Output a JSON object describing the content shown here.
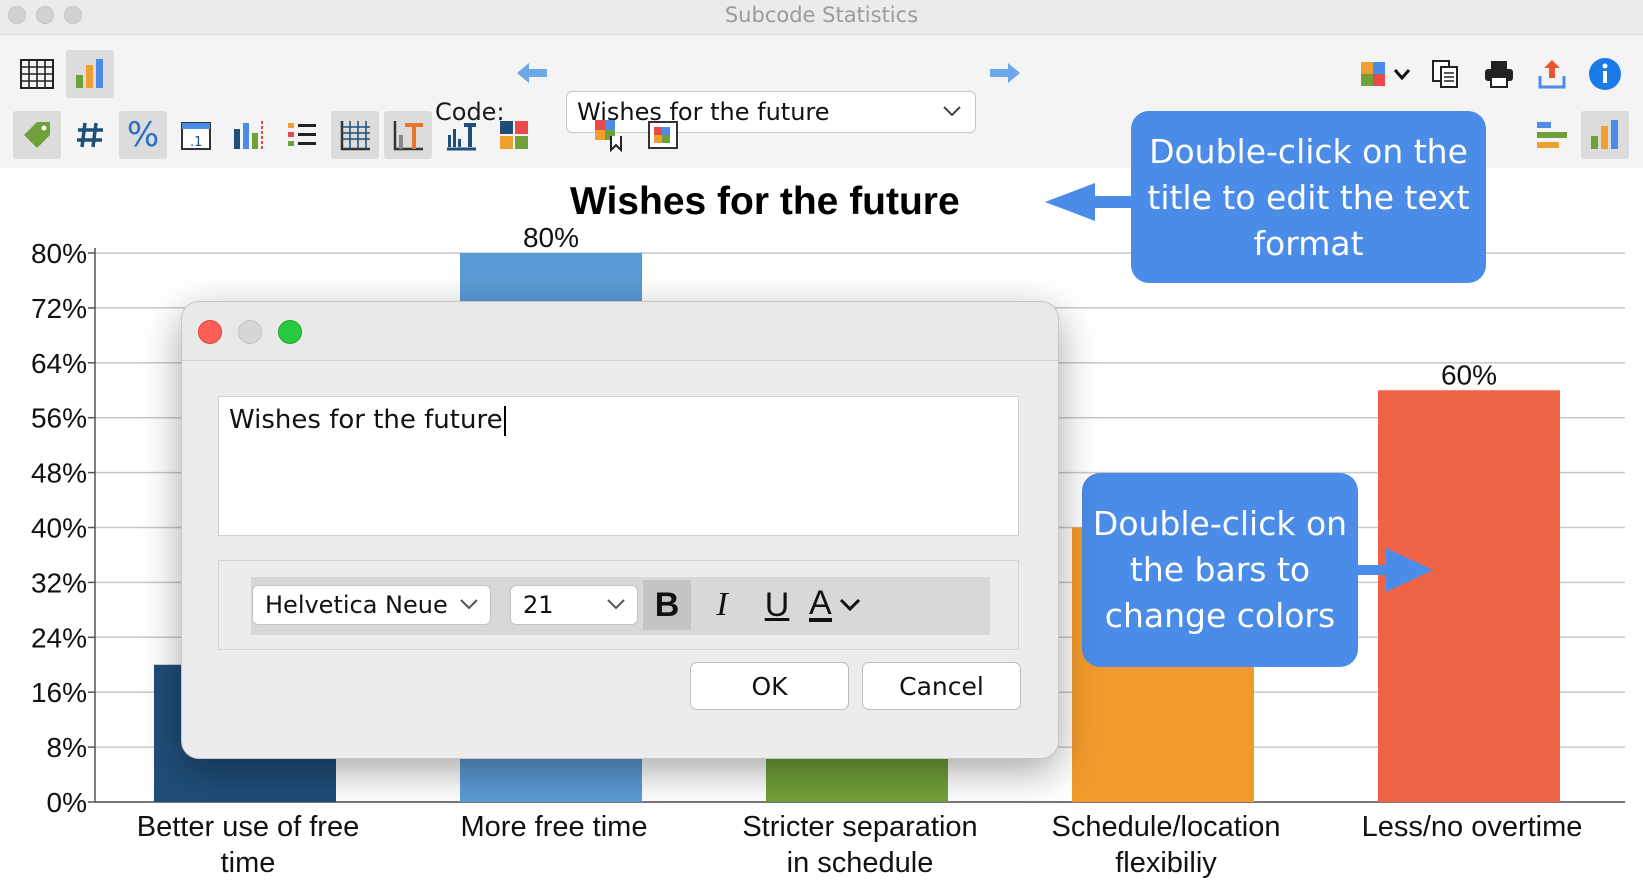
{
  "window": {
    "title": "Subcode Statistics"
  },
  "toolbar": {
    "code_label": "Code:",
    "code_value": "Wishes for the future",
    "icons": [
      "table-view-icon",
      "chart-view-icon",
      "back-arrow-icon",
      "forward-arrow-icon",
      "puzzle-icon",
      "copy-icon",
      "print-icon",
      "export-icon",
      "info-icon",
      "tag-icon",
      "number-icon",
      "percent-icon",
      "calendar-icon",
      "column-chart-icon",
      "list-icon",
      "grid-icon",
      "title-icon",
      "axis-icon",
      "colors-icon",
      "legend-icon",
      "frame-icon",
      "horizontal-bars-icon",
      "vertical-bars-icon"
    ]
  },
  "chart_data": {
    "type": "bar",
    "title": "Wishes for the future",
    "categories": [
      "Better use of free time",
      "More free time",
      "Stricter separation in schedule",
      "Schedule/location flexibiliy",
      "Less/no overtime"
    ],
    "category_lines": [
      [
        "Better use of free",
        "time"
      ],
      [
        "More free time"
      ],
      [
        "Stricter separation",
        "in schedule"
      ],
      [
        "Schedule/location",
        "flexibiliy"
      ],
      [
        "Less/no overtime"
      ]
    ],
    "values": [
      20,
      80,
      20,
      40,
      60
    ],
    "data_labels": [
      "",
      "80%",
      "",
      "",
      "60%"
    ],
    "colors": [
      "#1f4e79",
      "#5b9bd5",
      "#70a03a",
      "#f39a2c",
      "#ef6447"
    ],
    "ylim": [
      0,
      80
    ],
    "yticks": [
      "0%",
      "8%",
      "16%",
      "24%",
      "32%",
      "40%",
      "48%",
      "56%",
      "64%",
      "72%",
      "80%"
    ],
    "grid": true
  },
  "callouts": {
    "title_hint_lines": [
      "Double-click on the",
      "title to edit the text",
      "format"
    ],
    "bars_hint_lines": [
      "Double-click on",
      "the bars to",
      "change colors"
    ]
  },
  "dialog": {
    "text_value": "Wishes for the future",
    "font_name": "Helvetica Neue",
    "font_size": "21",
    "bold": "B",
    "italic": "I",
    "underline": "U",
    "color": "A",
    "ok": "OK",
    "cancel": "Cancel"
  }
}
